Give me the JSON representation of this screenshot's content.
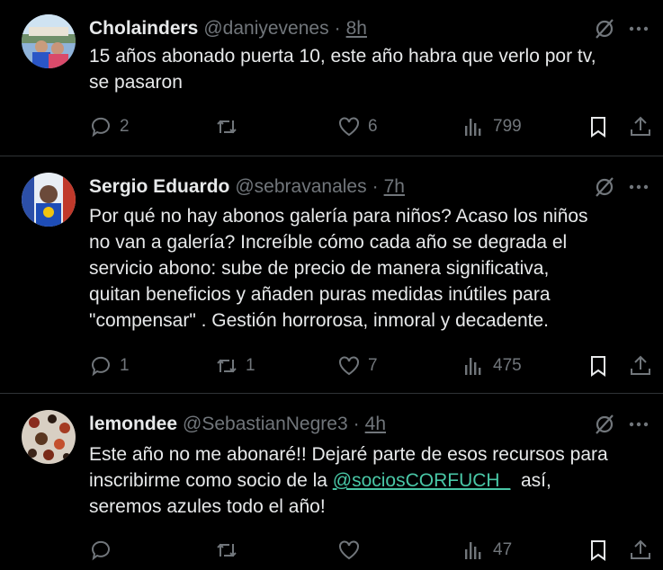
{
  "tweets": [
    {
      "name": "Cholainders",
      "handle": "@daniyevenes",
      "separator": "·",
      "time": "8h",
      "lines": [
        "15 años abonado puerta 10, este año habra que verlo por tv,",
        "se pasaron"
      ],
      "replies": "2",
      "retweets": "",
      "likes": "6",
      "views": "799"
    },
    {
      "name": "Sergio Eduardo",
      "handle": "@sebravanales",
      "separator": "·",
      "time": "7h",
      "lines": [
        "Por qué no hay abonos galería para niños? Acaso los niños",
        "no van a galería? Increíble cómo cada año se degrada el",
        "servicio abono: sube de precio de manera significativa,",
        "quitan beneficios y añaden puras medidas inútiles para",
        "\"compensar\" . Gestión horrorosa, inmoral y decadente."
      ],
      "replies": "1",
      "retweets": "1",
      "likes": "7",
      "views": "475"
    },
    {
      "name": "lemondee",
      "handle": "@SebastianNegre3",
      "separator": "·",
      "time": "4h",
      "line1": "Este año no me abonaré!! Dejaré parte de esos recursos para",
      "line2_before": "inscribirme como socio de la ",
      "line2_mention": "@sociosCORFUCH_",
      "line2_after": "  así,",
      "line3": "seremos azules todo el año!",
      "replies": "",
      "retweets": "",
      "likes": "",
      "views": "47"
    }
  ],
  "colors": {
    "background": "#000000",
    "text": "#e7e9ea",
    "secondary": "#71767b",
    "divider": "#2f3336",
    "mention": "#49c7a6"
  },
  "icons": [
    "reply-icon",
    "retweet-icon",
    "like-icon",
    "views-icon",
    "bookmark-icon",
    "share-icon",
    "grok-icon",
    "more-icon"
  ]
}
